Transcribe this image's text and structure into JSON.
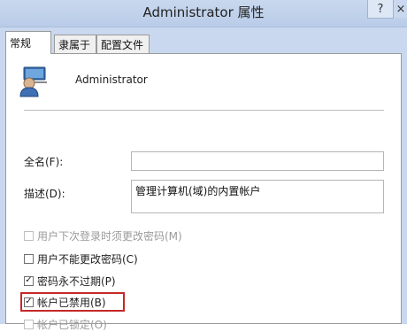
{
  "window": {
    "title": "Administrator 属性",
    "help_label": "?",
    "close_label": "×"
  },
  "tabs": [
    {
      "label": "常规",
      "active": true
    },
    {
      "label": "隶属于",
      "active": false
    },
    {
      "label": "配置文件",
      "active": false
    }
  ],
  "general": {
    "user_name": "Administrator",
    "full_name_label": "全名(F):",
    "full_name_value": "",
    "description_label": "描述(D):",
    "description_value": "管理计算机(域)的内置帐户",
    "checkboxes": [
      {
        "label": "用户下次登录时须更改密码(M)",
        "checked": false,
        "enabled": false
      },
      {
        "label": "用户不能更改密码(C)",
        "checked": false,
        "enabled": true
      },
      {
        "label": "密码永不过期(P)",
        "checked": true,
        "enabled": true
      },
      {
        "label": "帐户已禁用(B)",
        "checked": true,
        "enabled": true
      },
      {
        "label": "帐户已锁定(O)",
        "checked": false,
        "enabled": false
      }
    ]
  },
  "colors": {
    "titlebar": "#c9d8ee",
    "highlight_border": "#c62828"
  },
  "icons": {
    "user": "user-account-icon"
  }
}
